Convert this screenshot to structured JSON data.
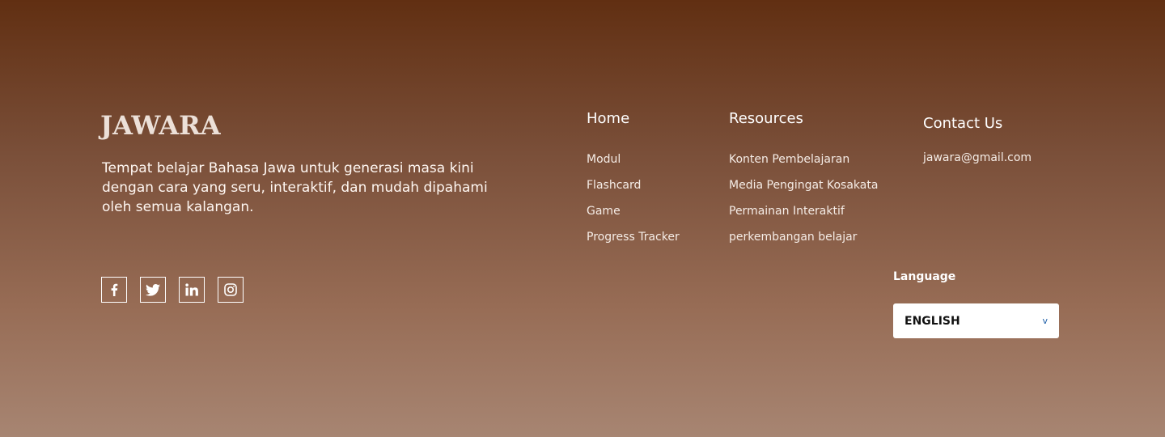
{
  "brand": {
    "logo": "JAWARA",
    "tagline": "Tempat belajar Bahasa Jawa untuk generasi masa kini dengan cara yang seru, interaktif, dan mudah dipahami oleh semua kalangan."
  },
  "social": [
    {
      "icon": "facebook-icon"
    },
    {
      "icon": "twitter-icon"
    },
    {
      "icon": "linkedin-icon"
    },
    {
      "icon": "instagram-icon"
    }
  ],
  "columns": {
    "home": {
      "title": "Home",
      "links": [
        "Modul",
        "Flashcard",
        "Game",
        "Progress Tracker"
      ]
    },
    "resources": {
      "title": "Resources",
      "links": [
        "Konten Pembelajaran",
        "Media Pengingat Kosakata",
        "Permainan Interaktif",
        "perkembangan belajar"
      ]
    },
    "contact": {
      "title": "Contact Us",
      "email": "jawara@gmail.com"
    }
  },
  "language": {
    "label": "Language",
    "selected": "ENGLISH",
    "chevron": "v"
  },
  "colors": {
    "gradient_top": "#612f12",
    "gradient_bottom": "#a78572",
    "chevron": "#1e5fa8"
  }
}
